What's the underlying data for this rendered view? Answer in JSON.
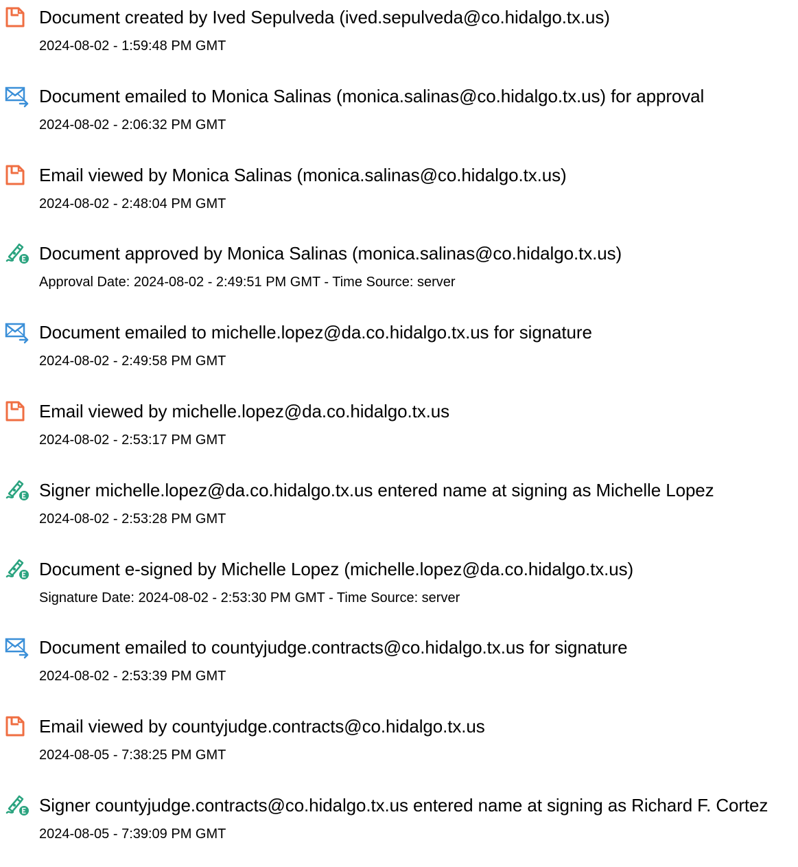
{
  "colors": {
    "doc_icon": "#ef6e42",
    "mail_icon": "#3a8fd8",
    "sign_icon": "#2aa37f"
  },
  "events": [
    {
      "icon": "document-icon",
      "title": "Document created by Ived Sepulveda (ived.sepulveda@co.hidalgo.tx.us)",
      "sub": "2024-08-02 - 1:59:48 PM GMT"
    },
    {
      "icon": "email-icon",
      "title": "Document emailed to Monica Salinas (monica.salinas@co.hidalgo.tx.us) for approval",
      "sub": "2024-08-02 - 2:06:32 PM GMT"
    },
    {
      "icon": "document-icon",
      "title": "Email viewed by Monica Salinas (monica.salinas@co.hidalgo.tx.us)",
      "sub": "2024-08-02 - 2:48:04 PM GMT"
    },
    {
      "icon": "signature-icon",
      "title": "Document approved by Monica Salinas (monica.salinas@co.hidalgo.tx.us)",
      "sub": "Approval Date: 2024-08-02 - 2:49:51 PM GMT - Time Source: server"
    },
    {
      "icon": "email-icon",
      "title": "Document emailed to michelle.lopez@da.co.hidalgo.tx.us for signature",
      "sub": "2024-08-02 - 2:49:58 PM GMT"
    },
    {
      "icon": "document-icon",
      "title": "Email viewed by michelle.lopez@da.co.hidalgo.tx.us",
      "sub": "2024-08-02 - 2:53:17 PM GMT"
    },
    {
      "icon": "signature-icon",
      "title": "Signer michelle.lopez@da.co.hidalgo.tx.us entered name at signing as Michelle Lopez",
      "sub": "2024-08-02 - 2:53:28 PM GMT"
    },
    {
      "icon": "signature-icon",
      "title": "Document e-signed by Michelle Lopez (michelle.lopez@da.co.hidalgo.tx.us)",
      "sub": "Signature Date: 2024-08-02 - 2:53:30 PM GMT - Time Source: server"
    },
    {
      "icon": "email-icon",
      "title": "Document emailed to countyjudge.contracts@co.hidalgo.tx.us for signature",
      "sub": "2024-08-02 - 2:53:39 PM GMT"
    },
    {
      "icon": "document-icon",
      "title": "Email viewed by countyjudge.contracts@co.hidalgo.tx.us",
      "sub": "2024-08-05 - 7:38:25 PM GMT"
    },
    {
      "icon": "signature-icon",
      "title": "Signer countyjudge.contracts@co.hidalgo.tx.us entered name at signing as Richard F. Cortez",
      "sub": "2024-08-05 - 7:39:09 PM GMT"
    }
  ]
}
